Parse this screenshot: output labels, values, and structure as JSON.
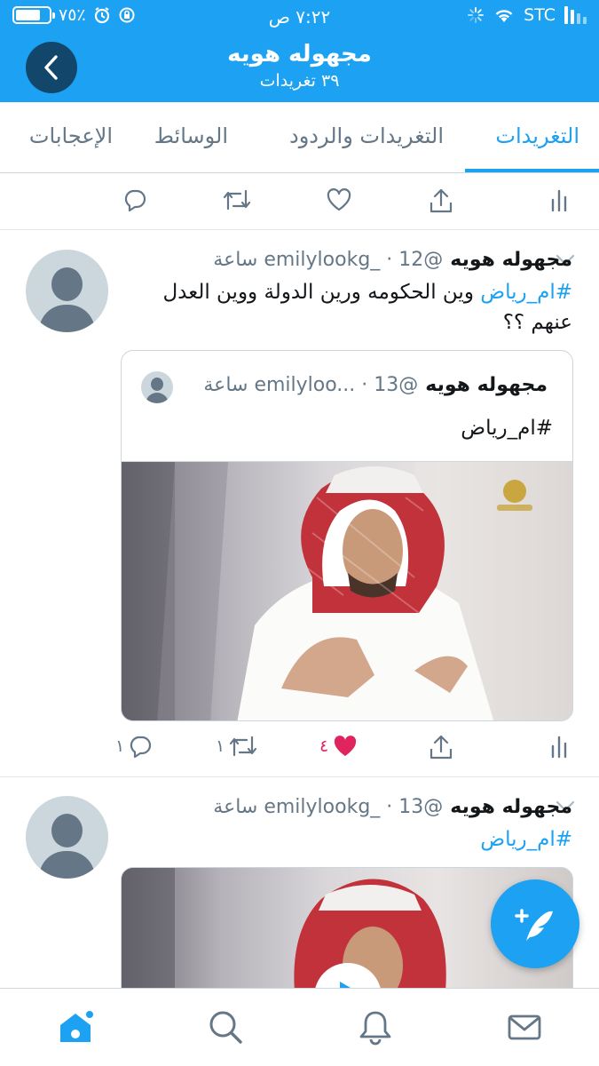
{
  "status_bar": {
    "battery_percent": "٧٥٪",
    "battery_level": 0.75,
    "time": "٧:٢٢ ص",
    "carrier": "STC"
  },
  "header": {
    "title": "مجهوله هويه",
    "subtitle": "٣٩ تغريدات"
  },
  "tabs": [
    {
      "label": "التغريدات",
      "active": true
    },
    {
      "label": "التغريدات والردود",
      "active": false
    },
    {
      "label": "الوسائط",
      "active": false
    },
    {
      "label": "الإعجابات",
      "active": false
    }
  ],
  "tweets": [
    {
      "name": "مجهوله هويه",
      "handle": "@emilylookg_",
      "time": "12 ساعة",
      "hashtag": "#ام_رياض",
      "text": " وين الحكومه ورين الدولة ووين العدل عنهم ؟؟",
      "quote": {
        "name": "مجهوله هويه",
        "handle": "@emilyloo...",
        "time": "13 ساعة",
        "text": "#ام_رياض"
      },
      "reply_count": "١",
      "retweet_count": "١",
      "like_count": "٤",
      "liked": true
    },
    {
      "name": "مجهوله هويه",
      "handle": "@emilylookg_",
      "time": "13 ساعة",
      "hashtag": "#ام_رياض"
    }
  ],
  "colors": {
    "brand": "#1da1f2",
    "like": "#e0245e",
    "muted": "#657786",
    "back_button": "#12476b"
  },
  "icons": {
    "back": "chevron-left-icon",
    "reply": "reply-icon",
    "retweet": "retweet-icon",
    "like": "heart-icon",
    "share": "share-icon",
    "analytics": "analytics-icon",
    "compose": "compose-tweet-icon",
    "home": "home-icon",
    "search": "search-icon",
    "notifications": "bell-icon",
    "messages": "mail-icon"
  }
}
